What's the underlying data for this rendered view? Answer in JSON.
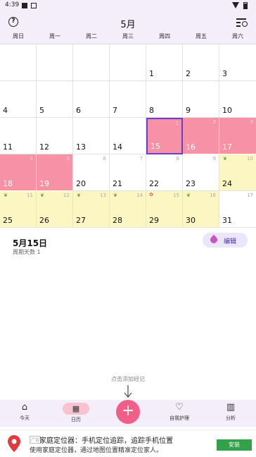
{
  "status": {
    "time": "4:39"
  },
  "header": {
    "title": "5月",
    "help": "?"
  },
  "weekdays": [
    "周日",
    "周一",
    "周二",
    "周三",
    "周四",
    "周五",
    "周六"
  ],
  "calendar": [
    {
      "n": "",
      "t": ""
    },
    {
      "n": "",
      "t": ""
    },
    {
      "n": "",
      "t": ""
    },
    {
      "n": "",
      "t": ""
    },
    {
      "n": "1",
      "t": ""
    },
    {
      "n": "2",
      "t": ""
    },
    {
      "n": "3",
      "t": ""
    },
    {
      "n": "4",
      "t": ""
    },
    {
      "n": "5",
      "t": ""
    },
    {
      "n": "6",
      "t": ""
    },
    {
      "n": "7",
      "t": ""
    },
    {
      "n": "8",
      "t": ""
    },
    {
      "n": "9",
      "t": ""
    },
    {
      "n": "10",
      "t": ""
    },
    {
      "n": "11",
      "t": ""
    },
    {
      "n": "12",
      "t": ""
    },
    {
      "n": "13",
      "t": ""
    },
    {
      "n": "14",
      "t": ""
    },
    {
      "n": "15",
      "s": "1",
      "t": "red",
      "sel": true
    },
    {
      "n": "16",
      "s": "2",
      "t": "red"
    },
    {
      "n": "17",
      "s": "3",
      "t": "red"
    },
    {
      "n": "18",
      "s": "4",
      "t": "red"
    },
    {
      "n": "19",
      "s": "5",
      "t": "red"
    },
    {
      "n": "20",
      "s": "6",
      "t": ""
    },
    {
      "n": "21",
      "s": "7",
      "t": ""
    },
    {
      "n": "22",
      "s": "8",
      "t": ""
    },
    {
      "n": "23",
      "s": "9",
      "t": ""
    },
    {
      "n": "24",
      "s": "10",
      "t": "yellow",
      "icon": "leaf"
    },
    {
      "n": "25",
      "s": "11",
      "t": "yellow",
      "icon": "leaf"
    },
    {
      "n": "26",
      "s": "12",
      "t": "yellow",
      "icon": "leaf"
    },
    {
      "n": "27",
      "s": "13",
      "t": "yellow",
      "icon": "leaf"
    },
    {
      "n": "28",
      "s": "14",
      "t": "yellow",
      "icon": "leaf"
    },
    {
      "n": "29",
      "s": "15",
      "t": "yellow",
      "icon": "flower"
    },
    {
      "n": "30",
      "s": "16",
      "t": "yellow",
      "icon": "leaf"
    },
    {
      "n": "31",
      "s": "17",
      "t": ""
    }
  ],
  "info": {
    "date": "5月15日",
    "cycle": "周期天数 1",
    "edit": "编辑"
  },
  "hint": "点击添加经记",
  "nav": [
    {
      "label": "今天",
      "icon": "⌂"
    },
    {
      "label": "日历",
      "icon": "▦"
    },
    {
      "label": "自我护理",
      "icon": "♡"
    },
    {
      "label": "分析",
      "icon": "▥"
    }
  ],
  "fab": "+",
  "ad": {
    "tag": "广告",
    "title": "家庭定位器：手机定位追踪，追踪手机位置",
    "desc": "使用家庭定位器，通过地图位置精准定位家人。",
    "button": "安装"
  },
  "colors": {
    "period": "#f691a6",
    "fertile": "#fbf6c2",
    "accent": "#ef5f88",
    "selected": "#6a3fd0"
  }
}
